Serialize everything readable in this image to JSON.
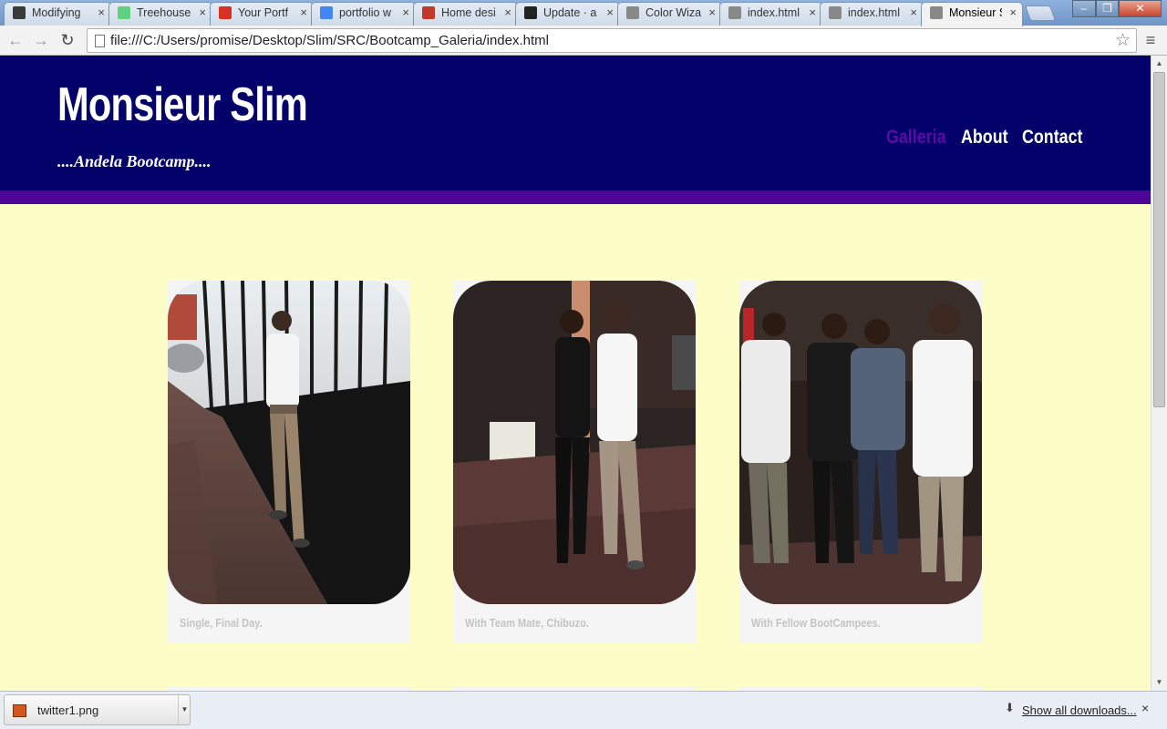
{
  "browser": {
    "tabs": [
      {
        "label": "Modifying",
        "icon": "document-icon",
        "color": "#3a3a3a"
      },
      {
        "label": "Treehouse",
        "icon": "treehouse-icon",
        "color": "#5fcf80"
      },
      {
        "label": "Your Portf",
        "icon": "gmail-icon",
        "color": "#d93025"
      },
      {
        "label": "portfolio w",
        "icon": "google-icon",
        "color": "#4285f4"
      },
      {
        "label": "Home desi",
        "icon": "paint-icon",
        "color": "#c0392b"
      },
      {
        "label": "Update · a",
        "icon": "github-icon",
        "color": "#222222"
      },
      {
        "label": "Color Wiza",
        "icon": "page-icon",
        "color": "#888888"
      },
      {
        "label": "index.html",
        "icon": "page-icon",
        "color": "#888888"
      },
      {
        "label": "index.html",
        "icon": "page-icon",
        "color": "#888888"
      },
      {
        "label": "Monsieur S",
        "icon": "page-icon",
        "color": "#888888",
        "active": true
      }
    ],
    "tab_close": "×",
    "address": "file:///C:/Users/promise/Desktop/Slim/SRC/Bootcamp_Galeria/index.html",
    "back_glyph": "←",
    "forward_glyph": "→",
    "reload_glyph": "↻",
    "star_glyph": "☆",
    "menu_glyph": "≡"
  },
  "site": {
    "brand": "Monsieur Slim",
    "tagline": "....Andela Bootcamp....",
    "nav": [
      {
        "label": "Galleria",
        "current": true
      },
      {
        "label": "About"
      },
      {
        "label": "Contact"
      }
    ],
    "colors": {
      "header": "#03026b",
      "accent": "#4d0497",
      "background": "#fdfdc8",
      "current_nav": "#5b0aa3"
    }
  },
  "gallery": [
    {
      "caption": "Single, Final Day."
    },
    {
      "caption": "With Team Mate, Chibuzo."
    },
    {
      "caption": "With Fellow BootCampees."
    }
  ],
  "downloads": {
    "file": "twitter1.png",
    "show_all": "Show all downloads...",
    "close_glyph": "×"
  }
}
